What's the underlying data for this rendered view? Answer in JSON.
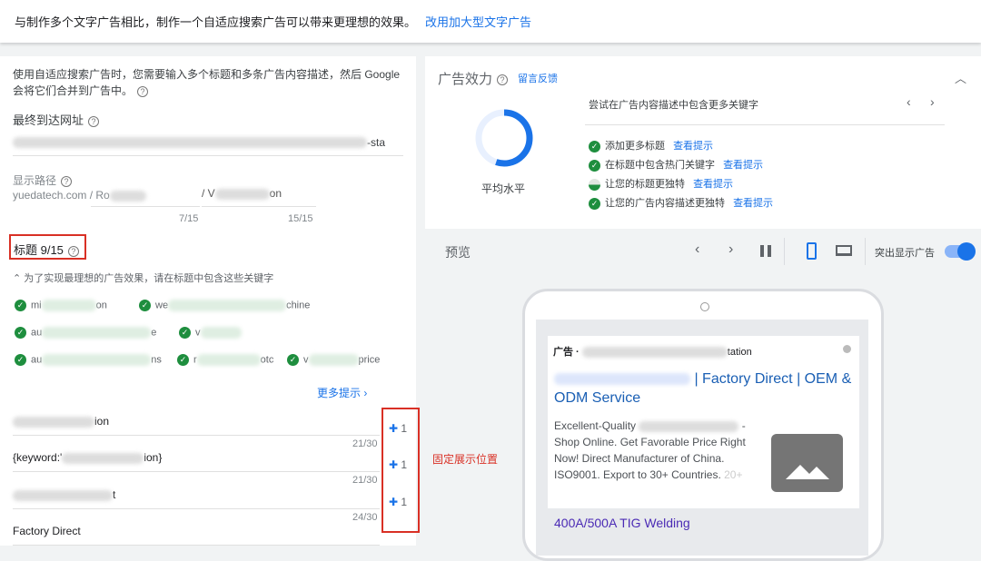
{
  "banner": {
    "text": "与制作多个文字广告相比，制作一个自适应搜索广告可以带来更理想的效果。",
    "link": "改用加大型文字广告"
  },
  "left": {
    "intro": "使用自适应搜索广告时，您需要输入多个标题和多条广告内容描述，然后 Google 会将它们合并到广告中。",
    "final_url_label": "最终到达网址",
    "final_url_suffix": "-sta",
    "display_path_label": "显示路径",
    "display_path_domain": "yuedatech.com / Ro",
    "path2_prefix": "/ V",
    "path2_suffix": "on",
    "path1_count": "7/15",
    "path2_count": "15/15",
    "headlines_label": "标题 9/15",
    "keyword_hint": "为了实现最理想的广告效果，请在标题中包含这些关键字",
    "keywords": [
      [
        "mi",
        "on"
      ],
      [
        "we",
        "chine"
      ],
      [
        "au",
        "e"
      ],
      [
        "v",
        ""
      ],
      [
        "au",
        "ns"
      ],
      [
        "r",
        "otc"
      ],
      [
        "v",
        "price"
      ]
    ],
    "more_tips": "更多提示",
    "headlines": [
      {
        "text": "ion",
        "count": "21/30",
        "pin": "1"
      },
      {
        "text": "{keyword:'",
        "suffix": "ion}",
        "count": "21/30",
        "pin": "1"
      },
      {
        "text": "t",
        "count": "24/30",
        "pin": "1"
      },
      {
        "text": "Factory Direct",
        "count": ""
      }
    ]
  },
  "annotation": "固定展示位置",
  "strength": {
    "title": "广告效力",
    "feedback": "留言反馈",
    "level": "平均水平",
    "progress": 0.55,
    "tip": "尝试在广告内容描述中包含更多关键字",
    "items": [
      {
        "text": "添加更多标题",
        "link": "查看提示"
      },
      {
        "text": "在标题中包含热门关键字",
        "link": "查看提示"
      },
      {
        "text": "让您的标题更独特",
        "link": "查看提示"
      },
      {
        "text": "让您的广告内容描述更独特",
        "link": "查看提示"
      }
    ]
  },
  "preview": {
    "title": "预览",
    "highlight_label": "突出显示广告",
    "highlight_on": true,
    "ad_label": "广告 ·",
    "ad_url_suffix": "tation",
    "headline": "| Factory Direct | OEM & ODM Service",
    "desc1": "Excellent-Quality",
    "desc2": "- Shop Online. Get Favorable Price Right Now! Direct Manufacturer of China. ISO9001. Export to 30+ Countries.",
    "desc_fade": "20+",
    "sitelink": "400A/500A TIG Welding"
  },
  "colors": {
    "accent": "#1a73e8",
    "check": "#1e8e3e",
    "annotation": "#d93025"
  }
}
